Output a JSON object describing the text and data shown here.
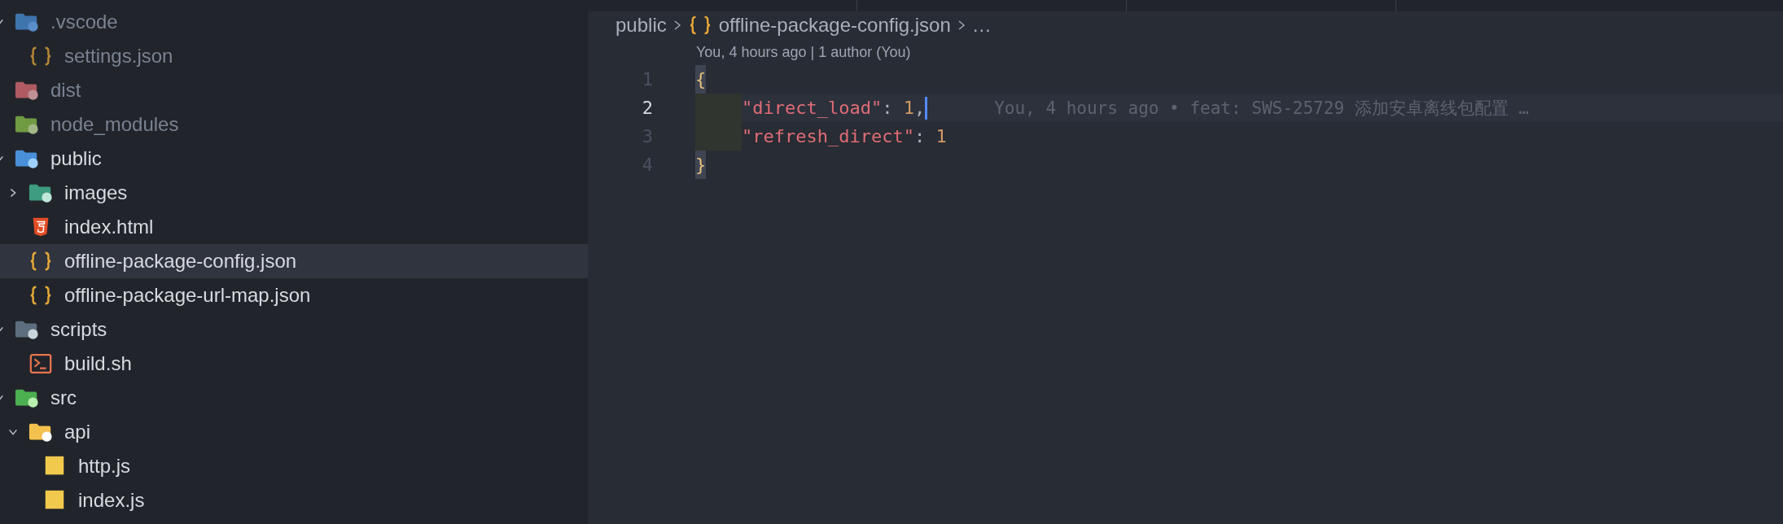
{
  "sidebar": {
    "tree": [
      {
        "label": ".vscode",
        "kind": "folder-vscode",
        "dimmed": true,
        "expanded": true,
        "selected": false,
        "children": [
          {
            "label": "settings.json",
            "kind": "json",
            "dimmed": true,
            "selected": false
          }
        ]
      },
      {
        "label": "dist",
        "kind": "folder-dist",
        "dimmed": true,
        "selected": false
      },
      {
        "label": "node_modules",
        "kind": "folder-node",
        "dimmed": true,
        "selected": false
      },
      {
        "label": "public",
        "kind": "folder-public",
        "dimmed": false,
        "expanded": true,
        "selected": false,
        "children": [
          {
            "label": "images",
            "kind": "folder-images",
            "dimmed": false,
            "expanded": false,
            "selected": false
          },
          {
            "label": "index.html",
            "kind": "html",
            "dimmed": false,
            "selected": false
          },
          {
            "label": "offline-package-config.json",
            "kind": "json",
            "dimmed": false,
            "selected": true
          },
          {
            "label": "offline-package-url-map.json",
            "kind": "json",
            "dimmed": false,
            "selected": false
          }
        ]
      },
      {
        "label": "scripts",
        "kind": "folder-scripts",
        "dimmed": false,
        "expanded": true,
        "selected": false,
        "children": [
          {
            "label": "build.sh",
            "kind": "shell",
            "dimmed": false,
            "selected": false
          }
        ]
      },
      {
        "label": "src",
        "kind": "folder-src",
        "dimmed": false,
        "expanded": true,
        "selected": false,
        "children": [
          {
            "label": "api",
            "kind": "folder-api",
            "dimmed": false,
            "expanded": true,
            "selected": false,
            "children": [
              {
                "label": "http.js",
                "kind": "js",
                "dimmed": false,
                "selected": false
              },
              {
                "label": "index.js",
                "kind": "js",
                "dimmed": false,
                "selected": false
              }
            ]
          }
        ]
      }
    ]
  },
  "editor": {
    "breadcrumb": {
      "folder": "public",
      "file": "offline-package-config.json",
      "more": "…"
    },
    "codelens": "You, 4 hours ago | 1 author (You)",
    "lines": [
      {
        "number": "1",
        "current": false,
        "tokens": [
          {
            "kind": "bracket",
            "text": "{"
          }
        ]
      },
      {
        "number": "2",
        "current": true,
        "blame": "You, 4 hours ago • feat: SWS-25729 添加安卓离线包配置 …",
        "tokens": [
          {
            "kind": "indent"
          },
          {
            "kind": "key",
            "text": "\"direct_load\""
          },
          {
            "kind": "punct",
            "text": ": "
          },
          {
            "kind": "number",
            "text": "1"
          },
          {
            "kind": "punct",
            "text": ","
          }
        ]
      },
      {
        "number": "3",
        "current": false,
        "tokens": [
          {
            "kind": "indent"
          },
          {
            "kind": "key",
            "text": "\"refresh_direct\""
          },
          {
            "kind": "punct",
            "text": ": "
          },
          {
            "kind": "number",
            "text": "1"
          }
        ]
      },
      {
        "number": "4",
        "current": false,
        "tokens": [
          {
            "kind": "bracket",
            "text": "}"
          }
        ]
      }
    ]
  }
}
